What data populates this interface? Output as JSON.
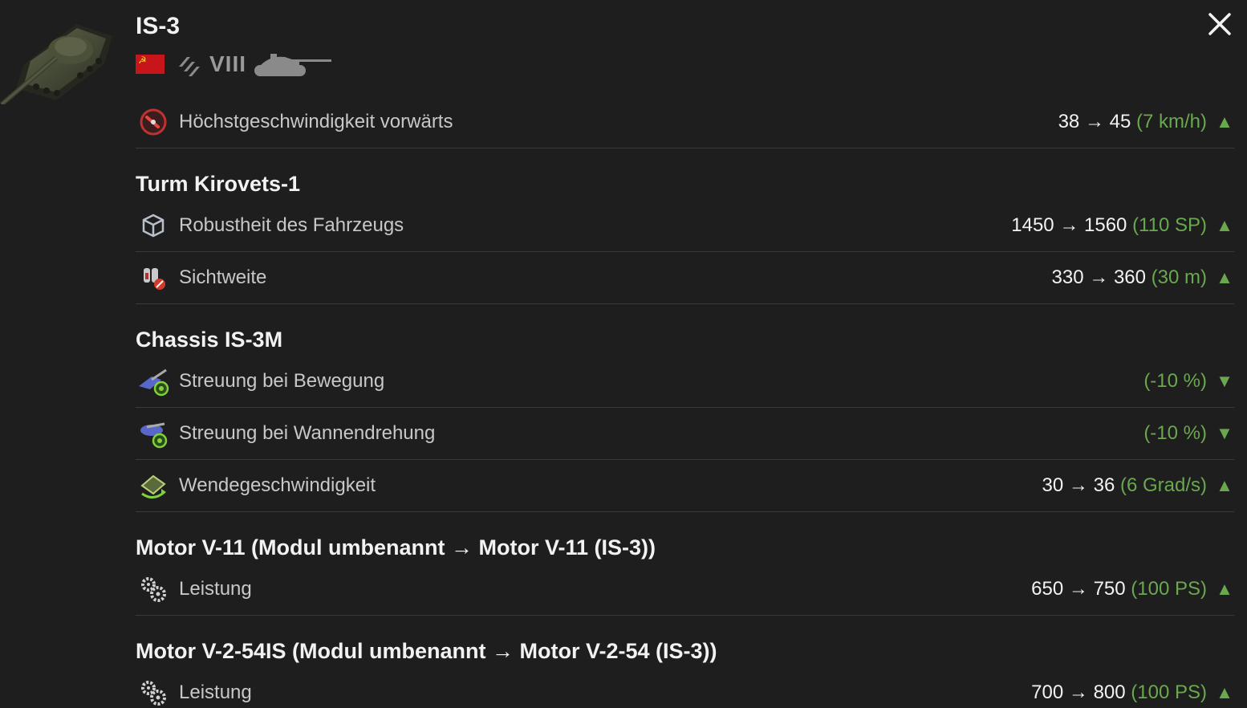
{
  "header": {
    "title": "IS-3",
    "tier": "VIII",
    "nation_flag": "ussr-flag",
    "class_icon": "heavy-tank-icon",
    "close_icon": "close-icon"
  },
  "colors": {
    "background": "#1e1e1e",
    "positive": "#6aa84f",
    "text_primary": "#f2f2f2",
    "text_secondary": "#c8c8c8"
  },
  "top_row": {
    "icon": "speed-gauge-icon",
    "label": "Höchstgeschwindigkeit vorwärts",
    "from": "38",
    "arrow": "→",
    "to": "45",
    "delta": "(7 km/h)",
    "trend": "▲"
  },
  "sections": [
    {
      "title": "Turm Kirovets-1",
      "rows": [
        {
          "icon": "armor-cube-icon",
          "label": "Robustheit des Fahrzeugs",
          "from": "1450",
          "arrow": "→",
          "to": "1560",
          "delta": "(110 SP)",
          "trend": "▲"
        },
        {
          "icon": "binoculars-icon",
          "label": "Sichtweite",
          "from": "330",
          "arrow": "→",
          "to": "360",
          "delta": "(30 m)",
          "trend": "▲"
        }
      ]
    },
    {
      "title": "Chassis IS-3M",
      "rows": [
        {
          "icon": "dispersion-movement-icon",
          "label": "Streuung bei Bewegung",
          "from": "",
          "arrow": "",
          "to": "",
          "delta": "(-10 %)",
          "trend": "▼"
        },
        {
          "icon": "dispersion-rotation-icon",
          "label": "Streuung bei Wannendrehung",
          "from": "",
          "arrow": "",
          "to": "",
          "delta": "(-10 %)",
          "trend": "▼"
        },
        {
          "icon": "traverse-speed-icon",
          "label": "Wendegeschwindigkeit",
          "from": "30",
          "arrow": "→",
          "to": "36",
          "delta": "(6 Grad/s)",
          "trend": "▲"
        }
      ]
    },
    {
      "title_pre": "Motor V-11 (Modul umbenannt ",
      "title_arrow": "→",
      "title_post": " Motor V-11 (IS-3))",
      "rows": [
        {
          "icon": "engine-gears-icon",
          "label": "Leistung",
          "from": "650",
          "arrow": "→",
          "to": "750",
          "delta": "(100 PS)",
          "trend": "▲"
        }
      ]
    },
    {
      "title_pre": "Motor V-2-54IS (Modul umbenannt ",
      "title_arrow": "→",
      "title_post": " Motor V-2-54 (IS-3))",
      "rows": [
        {
          "icon": "engine-gears-icon",
          "label": "Leistung",
          "from": "700",
          "arrow": "→",
          "to": "800",
          "delta": "(100 PS)",
          "trend": "▲"
        }
      ]
    }
  ]
}
